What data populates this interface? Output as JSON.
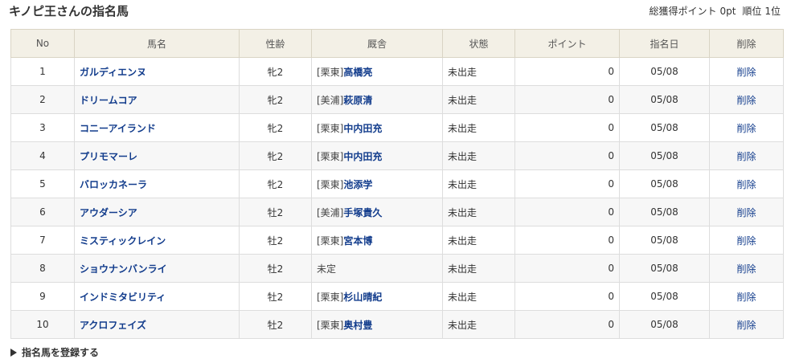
{
  "header": {
    "title": "キノピ王さんの指名馬",
    "total_points_label": "総獲得ポイント",
    "total_points_value": "0pt",
    "rank_label": "順位",
    "rank_value": "1位"
  },
  "table": {
    "columns": [
      "No",
      "馬名",
      "性齢",
      "厩舎",
      "状態",
      "ポイント",
      "指名日",
      "削除"
    ],
    "rows": [
      {
        "no": "1",
        "name": "ガルディエンヌ",
        "sex_age": "牝2",
        "area": "[栗東]",
        "trainer": "高橋亮",
        "status": "未出走",
        "points": "0",
        "date": "05/08",
        "delete": "削除"
      },
      {
        "no": "2",
        "name": "ドリームコア",
        "sex_age": "牝2",
        "area": "[美浦]",
        "trainer": "萩原清",
        "status": "未出走",
        "points": "0",
        "date": "05/08",
        "delete": "削除"
      },
      {
        "no": "3",
        "name": "コニーアイランド",
        "sex_age": "牝2",
        "area": "[栗東]",
        "trainer": "中内田充",
        "status": "未出走",
        "points": "0",
        "date": "05/08",
        "delete": "削除"
      },
      {
        "no": "4",
        "name": "プリモマーレ",
        "sex_age": "牝2",
        "area": "[栗東]",
        "trainer": "中内田充",
        "status": "未出走",
        "points": "0",
        "date": "05/08",
        "delete": "削除"
      },
      {
        "no": "5",
        "name": "バロッカネーラ",
        "sex_age": "牝2",
        "area": "[栗東]",
        "trainer": "池添学",
        "status": "未出走",
        "points": "0",
        "date": "05/08",
        "delete": "削除"
      },
      {
        "no": "6",
        "name": "アウダーシア",
        "sex_age": "牡2",
        "area": "[美浦]",
        "trainer": "手塚貴久",
        "status": "未出走",
        "points": "0",
        "date": "05/08",
        "delete": "削除"
      },
      {
        "no": "7",
        "name": "ミスティックレイン",
        "sex_age": "牡2",
        "area": "[栗東]",
        "trainer": "宮本博",
        "status": "未出走",
        "points": "0",
        "date": "05/08",
        "delete": "削除"
      },
      {
        "no": "8",
        "name": "ショウナンバンライ",
        "sex_age": "牡2",
        "area": "",
        "trainer": "未定",
        "status": "未出走",
        "points": "0",
        "date": "05/08",
        "delete": "削除"
      },
      {
        "no": "9",
        "name": "インドミタビリティ",
        "sex_age": "牡2",
        "area": "[栗東]",
        "trainer": "杉山晴紀",
        "status": "未出走",
        "points": "0",
        "date": "05/08",
        "delete": "削除"
      },
      {
        "no": "10",
        "name": "アクロフェイズ",
        "sex_age": "牡2",
        "area": "[栗東]",
        "trainer": "奥村豊",
        "status": "未出走",
        "points": "0",
        "date": "05/08",
        "delete": "削除"
      }
    ]
  },
  "footer": {
    "register_label": "指名馬を登録する",
    "register_icon": "triangle-right-icon"
  },
  "colors": {
    "link": "#123c8c",
    "header_bg": "#f3f0e6",
    "zebra_bg": "#f7f7f7",
    "border": "#dddddd"
  }
}
